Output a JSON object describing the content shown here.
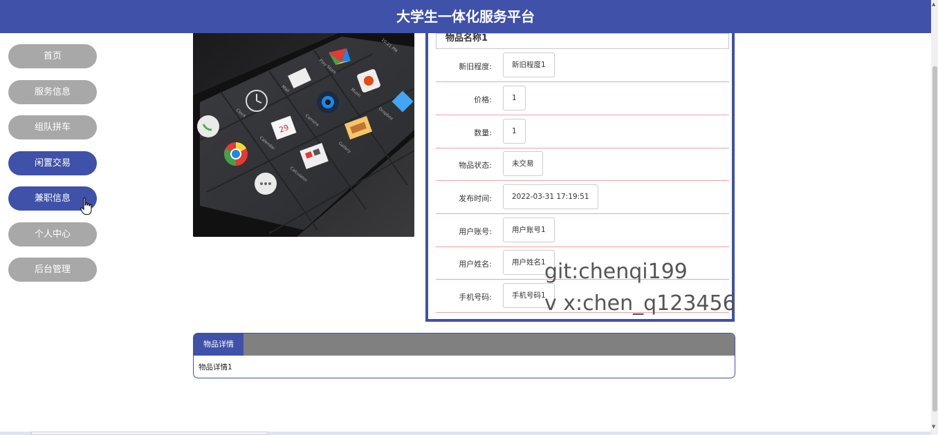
{
  "header": {
    "title": "大学生一体化服务平台"
  },
  "sidebar": {
    "items": [
      {
        "label": "首页",
        "active": false
      },
      {
        "label": "服务信息",
        "active": false
      },
      {
        "label": "组队拼车",
        "active": false
      },
      {
        "label": "闲置交易",
        "active": true
      },
      {
        "label": "兼职信息",
        "active": true
      },
      {
        "label": "个人中心",
        "active": false
      },
      {
        "label": "后台管理",
        "active": false
      }
    ]
  },
  "item": {
    "name": "物品名称1",
    "fields": [
      {
        "label": "新旧程度:",
        "value": "新旧程度1"
      },
      {
        "label": "价格:",
        "value": "1"
      },
      {
        "label": "数量:",
        "value": "1"
      },
      {
        "label": "物品状态:",
        "value": "未交易"
      },
      {
        "label": "发布时间:",
        "value": "2022-03-31 17:19:51"
      },
      {
        "label": "用户账号:",
        "value": "用户账号1"
      },
      {
        "label": "用户姓名:",
        "value": "用户姓名1"
      },
      {
        "label": "手机号码:",
        "value": "手机号码1"
      }
    ]
  },
  "watermark": {
    "line1": "git:chenqi199",
    "line2": "v x:chen_q123456"
  },
  "details": {
    "tab_label": "物品详情",
    "content": "物品详情1"
  },
  "colors": {
    "primary": "#3f51a8",
    "nav_inactive": "#a8a8a8",
    "row_divider": "#f0a0a8",
    "tab_bar": "#808080"
  },
  "icons": {
    "cursor": "hand-pointer-icon",
    "product_image": "smartphone-apps-photo"
  }
}
